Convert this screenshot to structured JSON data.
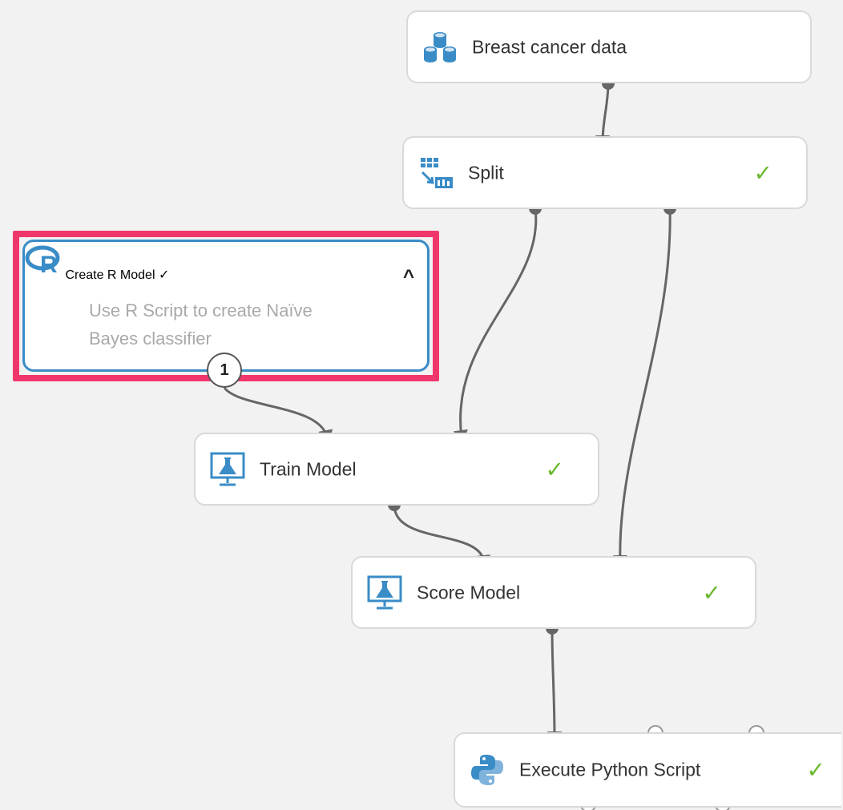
{
  "nodes": {
    "breast_cancer": {
      "title": "Breast cancer data",
      "icon": "dataset-icon"
    },
    "split": {
      "title": "Split",
      "icon": "split-data-icon",
      "status": "✓"
    },
    "create_r_model": {
      "title": "Create R Model",
      "description": "Use R Script to create Naïve Bayes classifier",
      "icon": "r-logo-icon",
      "status": "✓",
      "caret": "^",
      "port_label": "1"
    },
    "train_model": {
      "title": "Train Model",
      "icon": "flask-monitor-icon",
      "status": "✓"
    },
    "score_model": {
      "title": "Score Model",
      "icon": "flask-monitor-icon",
      "status": "✓"
    },
    "execute_python": {
      "title": "Execute Python Script",
      "icon": "python-logo-icon",
      "status": "✓"
    }
  },
  "colors": {
    "canvas": "#f2f2f2",
    "selection": "#f0376c",
    "selected_border": "#3a8cc7",
    "status_ok": "#6ab82e",
    "icon_blue": "#3a8cc7"
  }
}
